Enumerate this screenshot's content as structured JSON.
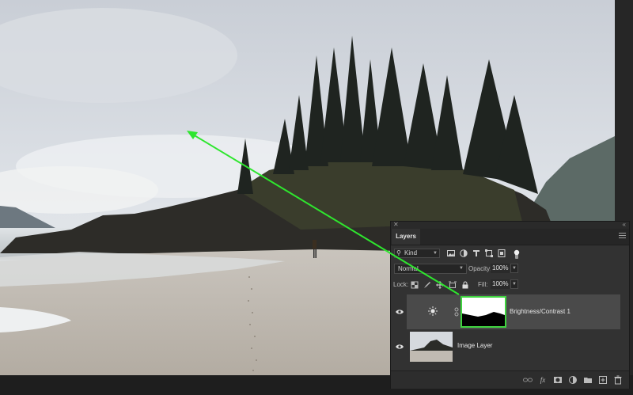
{
  "layers_panel": {
    "close_glyph": "✕",
    "collapse_glyph": "«",
    "tab_label": "Layers",
    "filter": {
      "kind_label": "Kind",
      "search_glyph": "⚲"
    },
    "blend_mode": "Normal",
    "opacity_label": "Opacity:",
    "opacity_value": "100%",
    "lock_label": "Lock:",
    "fill_label": "Fill:",
    "fill_value": "100%",
    "layers": [
      {
        "name": "Brightness/Contrast 1",
        "type": "adjustment",
        "visible": true,
        "selected": true,
        "icon": "sun-icon"
      },
      {
        "name": "Image Layer",
        "type": "pixel",
        "visible": true,
        "selected": false
      }
    ],
    "footer_icons": [
      "link-icon",
      "fx-icon",
      "mask-icon",
      "adjustment-icon",
      "folder-icon",
      "new-layer-icon",
      "trash-icon"
    ],
    "fx_label": "fx"
  },
  "annotation": {
    "arrow_color": "#2ee62e"
  },
  "accent": {
    "highlight": "#3fd43f"
  }
}
